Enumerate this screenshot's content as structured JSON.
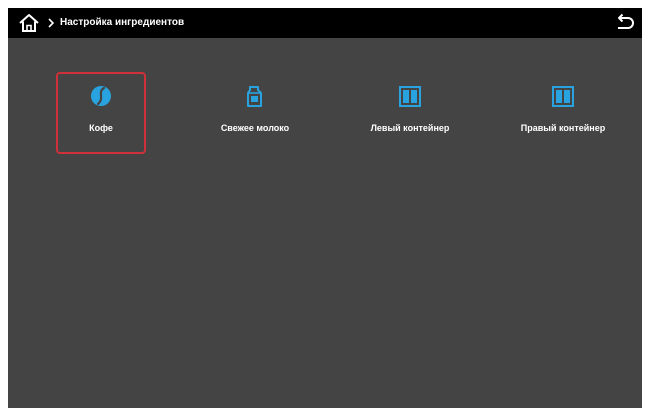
{
  "header": {
    "breadcrumb": "Настройка ингредиентов",
    "home_icon": "home-icon",
    "back_icon": "back-icon"
  },
  "tiles": [
    {
      "label": "Кофе",
      "icon": "coffee-bean-icon",
      "selected": true
    },
    {
      "label": "Свежее молоко",
      "icon": "milk-carton-icon",
      "selected": false
    },
    {
      "label": "Левый контейнер",
      "icon": "container-icon",
      "selected": false
    },
    {
      "label": "Правый контейнер",
      "icon": "container-icon",
      "selected": false
    }
  ],
  "colors": {
    "background": "#444444",
    "topbar": "#000000",
    "icon_accent": "#29a3e0",
    "selection_border": "#d0303a"
  }
}
